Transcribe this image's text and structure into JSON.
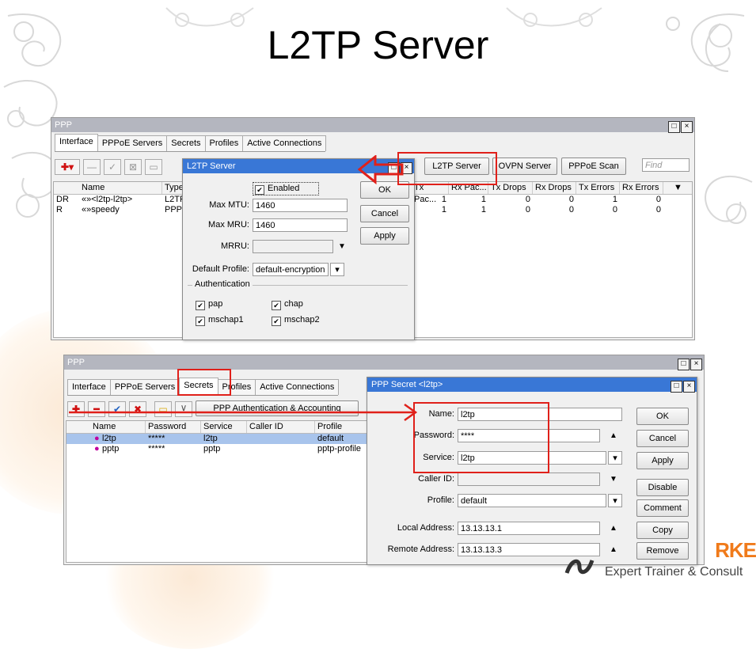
{
  "slide": {
    "title": "L2TP Server"
  },
  "win1": {
    "title": "PPP",
    "tabs": [
      "Interface",
      "PPPoE Servers",
      "Secrets",
      "Profiles",
      "Active Connections"
    ],
    "find_placeholder": "Find",
    "right_buttons": {
      "l2tp": "L2TP Server",
      "ovpn": "OVPN Server",
      "pppoe": "PPPoE Scan"
    },
    "columns": [
      "Name",
      "Type",
      "Tx Pac...",
      "Rx Pac...",
      "Tx Drops",
      "Rx Drops",
      "Tx Errors",
      "Rx Errors"
    ],
    "rows": [
      {
        "flag": "DR",
        "name": "«»<l2tp-l2tp>",
        "type": "L2TP",
        "tx_pac": "1",
        "rx_pac": "1",
        "tx_drops": "0",
        "rx_drops": "0",
        "tx_err": "1",
        "rx_err": "0"
      },
      {
        "flag": "R",
        "name": "«»speedy",
        "type": "PPPoE",
        "tx_pac": "1",
        "rx_pac": "1",
        "tx_drops": "0",
        "rx_drops": "0",
        "tx_err": "0",
        "rx_err": "0"
      }
    ]
  },
  "l2tp_dialog": {
    "title": "L2TP Server",
    "enabled_label": "Enabled",
    "max_mtu_label": "Max MTU:",
    "max_mtu": "1460",
    "max_mru_label": "Max MRU:",
    "max_mru": "1460",
    "mrru_label": "MRRU:",
    "mrru": "",
    "default_profile_label": "Default Profile:",
    "default_profile": "default-encryption",
    "auth_label": "Authentication",
    "pap": "pap",
    "chap": "chap",
    "mschap1": "mschap1",
    "mschap2": "mschap2",
    "ok": "OK",
    "cancel": "Cancel",
    "apply": "Apply"
  },
  "win2": {
    "title": "PPP",
    "tabs": [
      "Interface",
      "PPPoE Servers",
      "Secrets",
      "Profiles",
      "Active Connections"
    ],
    "auth_button": "PPP Authentication & Accounting",
    "columns": [
      "Name",
      "Password",
      "Service",
      "Caller ID",
      "Profile"
    ],
    "rows": [
      {
        "name": "l2tp",
        "password": "*****",
        "service": "l2tp",
        "caller_id": "",
        "profile": "default"
      },
      {
        "name": "pptp",
        "password": "*****",
        "service": "pptp",
        "caller_id": "",
        "profile": "pptp-profile"
      }
    ]
  },
  "secret_dialog": {
    "title": "PPP Secret <l2tp>",
    "name_label": "Name:",
    "name": "l2tp",
    "password_label": "Password:",
    "password": "****",
    "service_label": "Service:",
    "service": "l2tp",
    "caller_id_label": "Caller ID:",
    "caller_id": "",
    "profile_label": "Profile:",
    "profile": "default",
    "local_label": "Local Address:",
    "local": "13.13.13.1",
    "remote_label": "Remote Address:",
    "remote": "13.13.13.3",
    "buttons": {
      "ok": "OK",
      "cancel": "Cancel",
      "apply": "Apply",
      "disable": "Disable",
      "comment": "Comment",
      "copy": "Copy",
      "remove": "Remove"
    }
  },
  "footer": {
    "logo_text": "RKE",
    "tagline": "Expert Trainer & Consult"
  },
  "colors": {
    "annotation": "#e0201a",
    "dialog_title": "#3977d6",
    "selected_row": "#a8c4ec"
  }
}
